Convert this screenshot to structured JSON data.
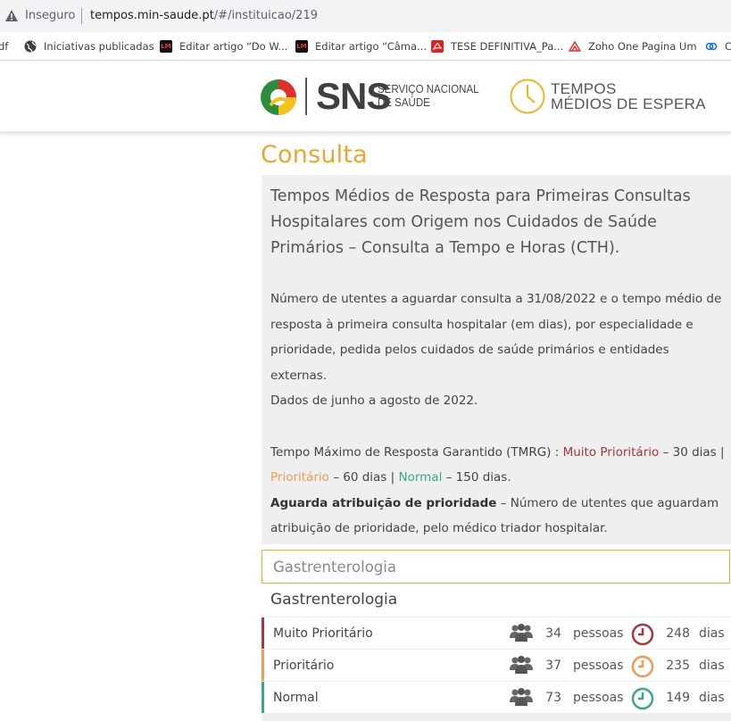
{
  "browser": {
    "security_label": "Inseguro",
    "url_host": "tempos.min-saude.pt",
    "url_path": "/#/instituicao/219"
  },
  "bookmarks": [
    {
      "label": "df",
      "icon": "pdf-icon"
    },
    {
      "label": "Iniciativas publicadas",
      "icon": "globe-icon"
    },
    {
      "label": "Editar artigo “Do W...",
      "icon": "lm-icon"
    },
    {
      "label": "Editar artigo “Câma...",
      "icon": "lm-icon"
    },
    {
      "label": "TESE DEFINITIVA_Pa...",
      "icon": "pdf-icon"
    },
    {
      "label": "Zoho One Pagina Um",
      "icon": "zoho-icon"
    },
    {
      "label": "C",
      "icon": "link-icon"
    }
  ],
  "header": {
    "sns_label": "SNS",
    "sns_sub_line1": "SERVIÇO NACIONAL",
    "sns_sub_line2": "DE SAÚDE",
    "tempos_line1": "TEMPOS",
    "tempos_line2": "MÉDIOS DE ESPERA"
  },
  "page_title": "Consulta",
  "info": {
    "heading": "Tempos Médios de Resposta para Primeiras Consultas Hospitalares com Origem nos Cuidados de Saúde Primários – Consulta a Tempo e Horas (CTH).",
    "paragraph1": "Número de utentes a aguardar consulta a 31/08/2022 e o tempo médio de resposta à primeira consulta hospitalar (em dias), por especialidade e prioridade, pedida pelos cuidados de saúde primários e entidades externas.",
    "paragraph2": "Dados de junho a agosto de 2022.",
    "tmrg_intro": "Tempo Máximo de Resposta Garantido (TMRG) : ",
    "tmrg_mp": "Muito Prioritário",
    "tmrg_mp_days": " – 30 dias | ",
    "tmrg_p": "Prioritário",
    "tmrg_p_days": " – 60 dias | ",
    "tmrg_n": "Normal",
    "tmrg_n_days": " – 150 dias.",
    "await_bold": "Aguarda atribuição de prioridade",
    "await_text": " – Número de utentes que aguardam atribuição de prioridade, pelo médico triador hospitalar."
  },
  "select": {
    "value": "Gastrenterologia"
  },
  "specialty": "Gastrenterologia",
  "rows": [
    {
      "label": "Muito Prioritário",
      "people": "34",
      "people_unit": "pessoas",
      "days": "248",
      "days_unit": "dias",
      "color": "#a8373c"
    },
    {
      "label": "Prioritário",
      "people": "37",
      "people_unit": "pessoas",
      "days": "235",
      "days_unit": "dias",
      "color": "#ef9a55"
    },
    {
      "label": "Normal",
      "people": "73",
      "people_unit": "pessoas",
      "days": "149",
      "days_unit": "dias",
      "color": "#3aa883"
    }
  ]
}
